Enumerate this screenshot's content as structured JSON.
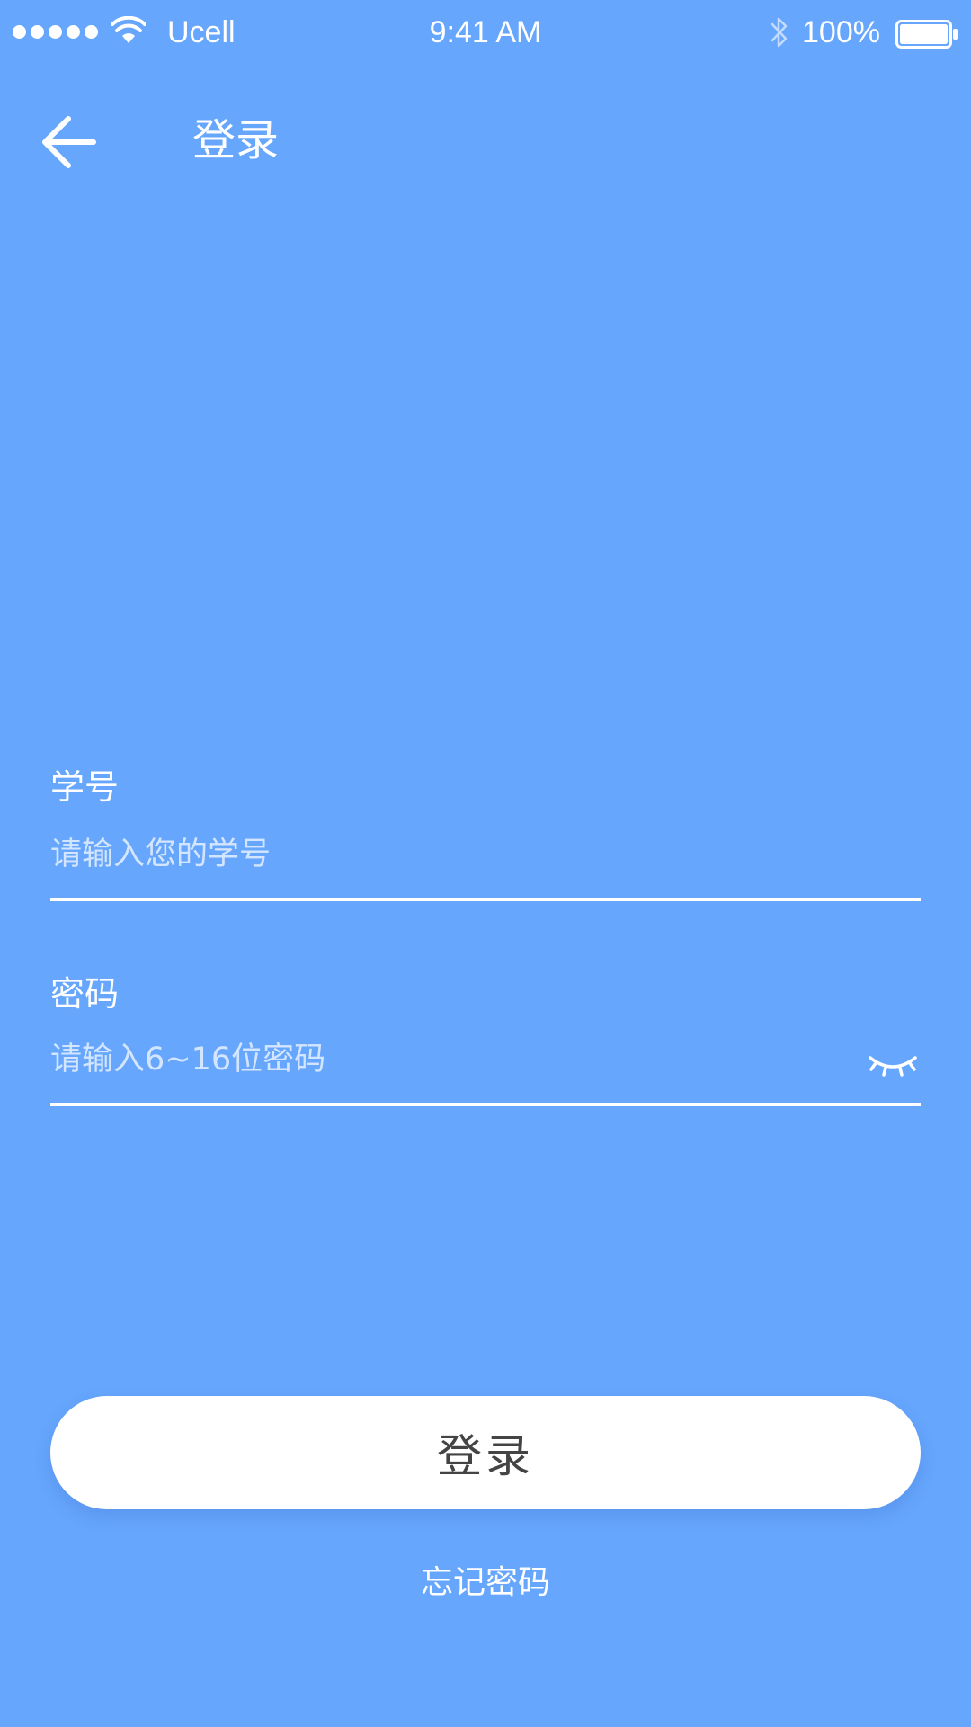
{
  "status_bar": {
    "carrier": "Ucell",
    "time": "9:41 AM",
    "battery": "100%",
    "signal_bars": 5
  },
  "nav": {
    "back_icon": "arrow-left-icon",
    "title": "登录"
  },
  "form": {
    "student_id": {
      "label": "学号",
      "placeholder": "请输入您的学号",
      "value": ""
    },
    "password": {
      "label": "密码",
      "placeholder": "请输入6~16位密码",
      "value": "",
      "toggle_icon": "eye-closed-icon"
    }
  },
  "actions": {
    "login_label": "登录",
    "forgot_label": "忘记密码"
  },
  "colors": {
    "background": "#66a6fd",
    "button_bg": "#ffffff",
    "button_text": "#444444"
  }
}
